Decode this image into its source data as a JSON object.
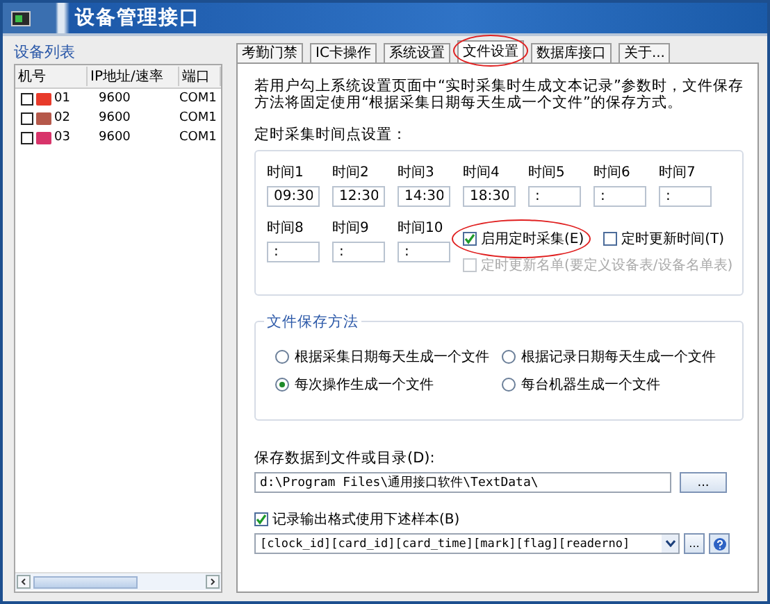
{
  "window": {
    "title": "设备管理接口"
  },
  "device_list": {
    "title": "设备列表",
    "columns": [
      "机号",
      "IP地址/速率",
      "端口"
    ],
    "rows": [
      {
        "checked": false,
        "color": "#e83a2a",
        "number": "01",
        "rate": "9600",
        "port": "COM1"
      },
      {
        "checked": false,
        "color": "#b5584a",
        "number": "02",
        "rate": "9600",
        "port": "COM1"
      },
      {
        "checked": false,
        "color": "#d8346a",
        "number": "03",
        "rate": "9600",
        "port": "COM1"
      }
    ]
  },
  "tabs": [
    {
      "label": "考勤门禁",
      "selected": false,
      "highlighted": false
    },
    {
      "label": "IC卡操作",
      "selected": false,
      "highlighted": false
    },
    {
      "label": "系统设置",
      "selected": false,
      "highlighted": false
    },
    {
      "label": "文件设置",
      "selected": true,
      "highlighted": true
    },
    {
      "label": "数据库接口",
      "selected": false,
      "highlighted": false
    },
    {
      "label": "关于...",
      "selected": false,
      "highlighted": false
    }
  ],
  "notice": "若用户勾上系统设置页面中“实时采集时生成文本记录”参数时，文件保存方法将固定使用“根据采集日期每天生成一个文件”的保存方式。",
  "schedule": {
    "title": "定时采集时间点设置：",
    "times": [
      {
        "label": "时间1",
        "value": "09:30"
      },
      {
        "label": "时间2",
        "value": "12:30"
      },
      {
        "label": "时间3",
        "value": "14:30"
      },
      {
        "label": "时间4",
        "value": "18:30"
      },
      {
        "label": "时间5",
        "value": ":"
      },
      {
        "label": "时间6",
        "value": ":"
      },
      {
        "label": "时间7",
        "value": ":"
      },
      {
        "label": "时间8",
        "value": ":"
      },
      {
        "label": "时间9",
        "value": ":"
      },
      {
        "label": "时间10",
        "value": ":"
      }
    ],
    "options": [
      {
        "label": "启用定时采集(E)",
        "checked": true,
        "disabled": false,
        "highlighted": true
      },
      {
        "label": "定时更新时间(T)",
        "checked": false,
        "disabled": false,
        "highlighted": false
      },
      {
        "label": "定时更新名单(要定义设备表/设备名单表)",
        "checked": false,
        "disabled": true,
        "highlighted": false
      }
    ]
  },
  "save_method": {
    "title": "文件保存方法",
    "options": [
      {
        "label": "根据采集日期每天生成一个文件",
        "selected": false
      },
      {
        "label": "根据记录日期每天生成一个文件",
        "selected": false
      },
      {
        "label": "每次操作生成一个文件",
        "selected": true
      },
      {
        "label": "每台机器生成一个文件",
        "selected": false
      }
    ]
  },
  "save_path": {
    "label": "保存数据到文件或目录(D):",
    "value": "d:\\Program Files\\通用接口软件\\TextData\\",
    "button": "..."
  },
  "output_format": {
    "label": "记录输出格式使用下述样本(B)",
    "checked": true,
    "value": "[clock_id][card_id][card_time][mark][flag][readerno]",
    "button": "..."
  }
}
